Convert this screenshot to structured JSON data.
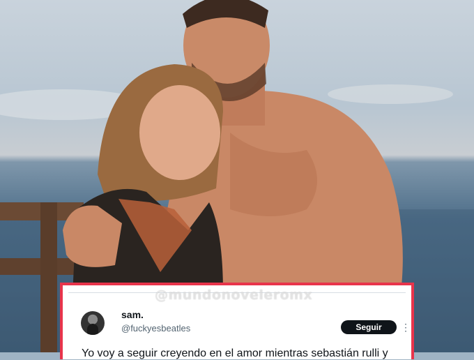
{
  "watermark": "@mundonoveleromx",
  "tweet": {
    "user_name": "sam.",
    "user_handle": "@fuckyesbeatles",
    "follow_label": "Seguir",
    "more_glyph": "⋮",
    "text_line1": "Yo voy a seguir creyendo en el amor mientras sebastián rulli y",
    "text_line2": ""
  },
  "colors": {
    "frame_red": "#e8344b",
    "button_dark": "#0f1419",
    "handle_gray": "#536471"
  }
}
